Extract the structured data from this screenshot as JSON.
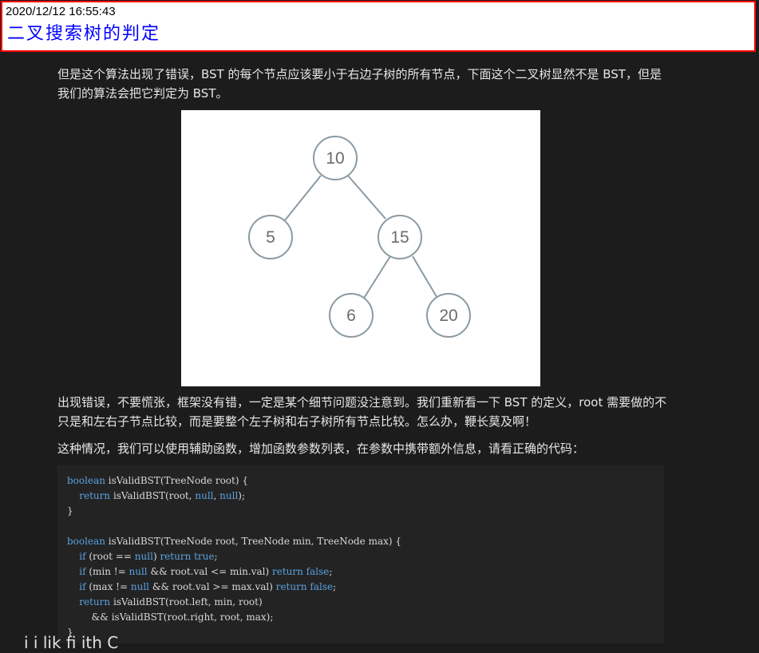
{
  "header": {
    "timestamp": "2020/12/12 16:55:43",
    "title": "二叉搜索树的判定"
  },
  "content": {
    "para1": "但是这个算法出现了错误，BST 的每个节点应该要小于右边子树的所有节点，下面这个二叉树显然不是 BST，但是我们的算法会把它判定为 BST。",
    "para2": "出现错误，不要慌张，框架没有错，一定是某个细节问题没注意到。我们重新看一下 BST 的定义，root 需要做的不只是和左右子节点比较，而是要整个左子树和右子树所有节点比较。怎么办，鞭长莫及啊！",
    "para3": "这种情况，我们可以使用辅助函数，增加函数参数列表，在参数中携带额外信息，请看正确的代码：",
    "bottom_partial": "i   i   lik      fi             ith          C"
  },
  "tree": {
    "nodes": [
      "10",
      "5",
      "15",
      "6",
      "20"
    ]
  },
  "code": {
    "l1": [
      {
        "t": "boolean",
        "k": 1
      },
      {
        "t": " isValidBST(TreeNode root) {"
      }
    ],
    "l2": [
      {
        "t": "    "
      },
      {
        "t": "return",
        "k": 1
      },
      {
        "t": " isValidBST(root, "
      },
      {
        "t": "null",
        "k": 1
      },
      {
        "t": ", "
      },
      {
        "t": "null",
        "k": 1
      },
      {
        "t": ");"
      }
    ],
    "l3": [
      {
        "t": "}"
      }
    ],
    "l4": [
      {
        "t": ""
      }
    ],
    "l5": [
      {
        "t": "boolean",
        "k": 1
      },
      {
        "t": " isValidBST(TreeNode root, TreeNode min, TreeNode max) {"
      }
    ],
    "l6": [
      {
        "t": "    "
      },
      {
        "t": "if",
        "k": 1
      },
      {
        "t": " (root == "
      },
      {
        "t": "null",
        "k": 1
      },
      {
        "t": ") "
      },
      {
        "t": "return true",
        "k": 1
      },
      {
        "t": ";"
      }
    ],
    "l7": [
      {
        "t": "    "
      },
      {
        "t": "if",
        "k": 1
      },
      {
        "t": " (min != "
      },
      {
        "t": "null",
        "k": 1
      },
      {
        "t": " && root.val <= min.val) "
      },
      {
        "t": "return false",
        "k": 1
      },
      {
        "t": ";"
      }
    ],
    "l8": [
      {
        "t": "    "
      },
      {
        "t": "if",
        "k": 1
      },
      {
        "t": " (max != "
      },
      {
        "t": "null",
        "k": 1
      },
      {
        "t": " && root.val >= max.val) "
      },
      {
        "t": "return false",
        "k": 1
      },
      {
        "t": ";"
      }
    ],
    "l9": [
      {
        "t": "    "
      },
      {
        "t": "return",
        "k": 1
      },
      {
        "t": " isValidBST(root.left, min, root)"
      }
    ],
    "l10": [
      {
        "t": "        && isValidBST(root.right, root, max);"
      }
    ],
    "l11": [
      {
        "t": "}"
      }
    ]
  },
  "colors": {
    "header_border": "#ff0000",
    "title": "#0000ff",
    "keyword": "#5aa2e0",
    "node_stroke": "#8a9aa3"
  }
}
